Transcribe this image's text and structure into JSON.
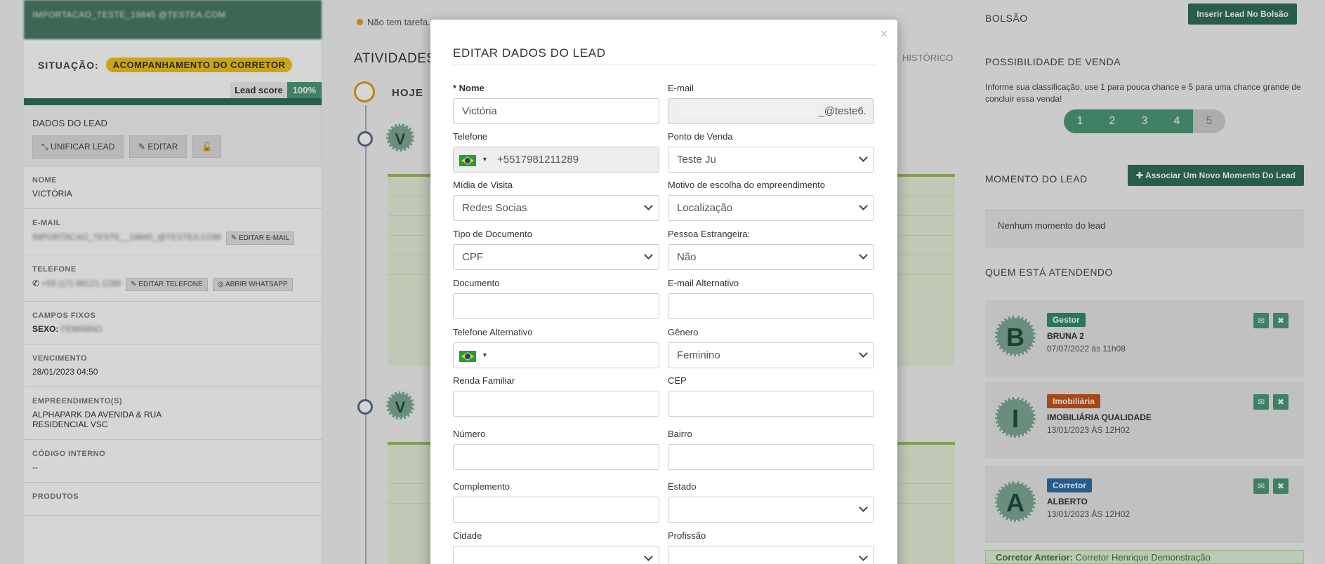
{
  "left": {
    "header_blurred": "IMPORTACAO_TESTE_19845 @TESTEA.COM",
    "situacao_label": "SITUAÇÃO:",
    "situacao_value": "ACOMPANHAMENTO DO CORRETOR",
    "leadscore_label": "Lead score",
    "leadscore_value": "100%",
    "dados_title": "DADOS DO LEAD",
    "btn_unificar": "UNIFICAR LEAD",
    "btn_editar": "EDITAR",
    "lock_icon": "lock-open-icon",
    "nome_label": "NOME",
    "nome_value": "VICTÓRIA",
    "email_label": "E-MAIL",
    "email_value_blurred": "IMPORTACAO_TESTE__19845_@TESTEA.COM",
    "btn_editar_email": "EDITAR E-MAIL",
    "telefone_label": "TELEFONE",
    "telefone_value_blurred": "+55 (17) 98121-1289",
    "btn_editar_telefone": "EDITAR TELEFONE",
    "btn_abrir_whatsapp": "ABRIR WHATSAPP",
    "campos_fixos_label": "CAMPOS FIXOS",
    "sexo_label": "SEXO:",
    "sexo_value_blurred": "FEMININO",
    "vencimento_label": "VENCIMENTO",
    "vencimento_value": "28/01/2023 04:50",
    "empreendimentos_label": "EMPREENDIMENTO(S)",
    "empreendimentos_value1": "ALPHAPARK DA AVENIDA & RUA",
    "empreendimentos_value2": "RESIDENCIAL VSC",
    "codigo_label": "CÓDIGO INTERNO",
    "codigo_value": "--",
    "produtos_label": "PRODUTOS"
  },
  "middle": {
    "no_task": "Não tem tarefa.",
    "atividades_title": "ATIVIDADES",
    "historico_tab": "HISTÓRICO",
    "hoje_label": "HOJE",
    "avatar_letter": "V"
  },
  "right": {
    "bolsao_title": "BOLSÃO",
    "btn_inserir_bolsao": "Inserir Lead No Bolsão",
    "possibilidade_title": "POSSIBILIDADE DE VENDA",
    "possibilidade_text": "Informe sua classificação, use 1 para pouca chance e 5 para uma chance grande de concluir essa venda!",
    "scale": [
      "1",
      "2",
      "3",
      "4",
      "5"
    ],
    "momento_title": "MOMENTO DO LEAD",
    "btn_associar": "✚ Associar Um Novo Momento Do Lead",
    "momento_empty": "Nenhum momento do lead",
    "quem_title": "QUEM ESTÁ ATENDENDO",
    "people": [
      {
        "letter": "B",
        "role": "Gestor",
        "role_color": "#2f8f6b",
        "name": "BRUNA 2",
        "date": "07/07/2022 às 11h08"
      },
      {
        "letter": "I",
        "role": "Imobiliária",
        "role_color": "#c9541a",
        "name": "IMOBILIÁRIA QUALIDADE",
        "date": "13/01/2023 ÀS 12H02"
      },
      {
        "letter": "A",
        "role": "Corretor",
        "role_color": "#2a6fa8",
        "name": "ALBERTO",
        "date": "13/01/2023 ÀS 12H02"
      }
    ],
    "corretor_anterior_label": "Corretor Anterior:",
    "corretor_anterior_value": "Corretor Henrique Demonstração"
  },
  "modal": {
    "title": "EDITAR DADOS DO LEAD",
    "close": "×",
    "fields": {
      "nome": {
        "label": "* Nome",
        "value": "Victória"
      },
      "email": {
        "label": "E-mail",
        "value_suffix": "_@teste6."
      },
      "telefone": {
        "label": "Telefone",
        "value": "+5517981211289"
      },
      "ponto_venda": {
        "label": "Ponto de Venda",
        "value": "Teste Ju"
      },
      "midia": {
        "label": "Mídia de Visita",
        "value": "Redes Socias"
      },
      "motivo": {
        "label": "Motivo de escolha do empreendimento",
        "value": "Localização"
      },
      "tipo_doc": {
        "label": "Tipo de Documento",
        "value": "CPF"
      },
      "estrangeira": {
        "label": "Pessoa Estrangeira:",
        "value": "Não"
      },
      "documento": {
        "label": "Documento",
        "value": ""
      },
      "email_alt": {
        "label": "E-mail Alternativo",
        "value": ""
      },
      "tel_alt": {
        "label": "Telefone Alternativo",
        "value": ""
      },
      "genero": {
        "label": "Gênero",
        "value": "Feminino"
      },
      "renda": {
        "label": "Renda Familiar",
        "value": ""
      },
      "cep": {
        "label": "CEP",
        "value": ""
      },
      "numero": {
        "label": "Número",
        "value": ""
      },
      "bairro": {
        "label": "Bairro",
        "value": ""
      },
      "complemento": {
        "label": "Complemento",
        "value": ""
      },
      "estado": {
        "label": "Estado",
        "value": ""
      },
      "cidade": {
        "label": "Cidade",
        "value": ""
      },
      "profissao": {
        "label": "Profissão",
        "value": ""
      }
    }
  }
}
